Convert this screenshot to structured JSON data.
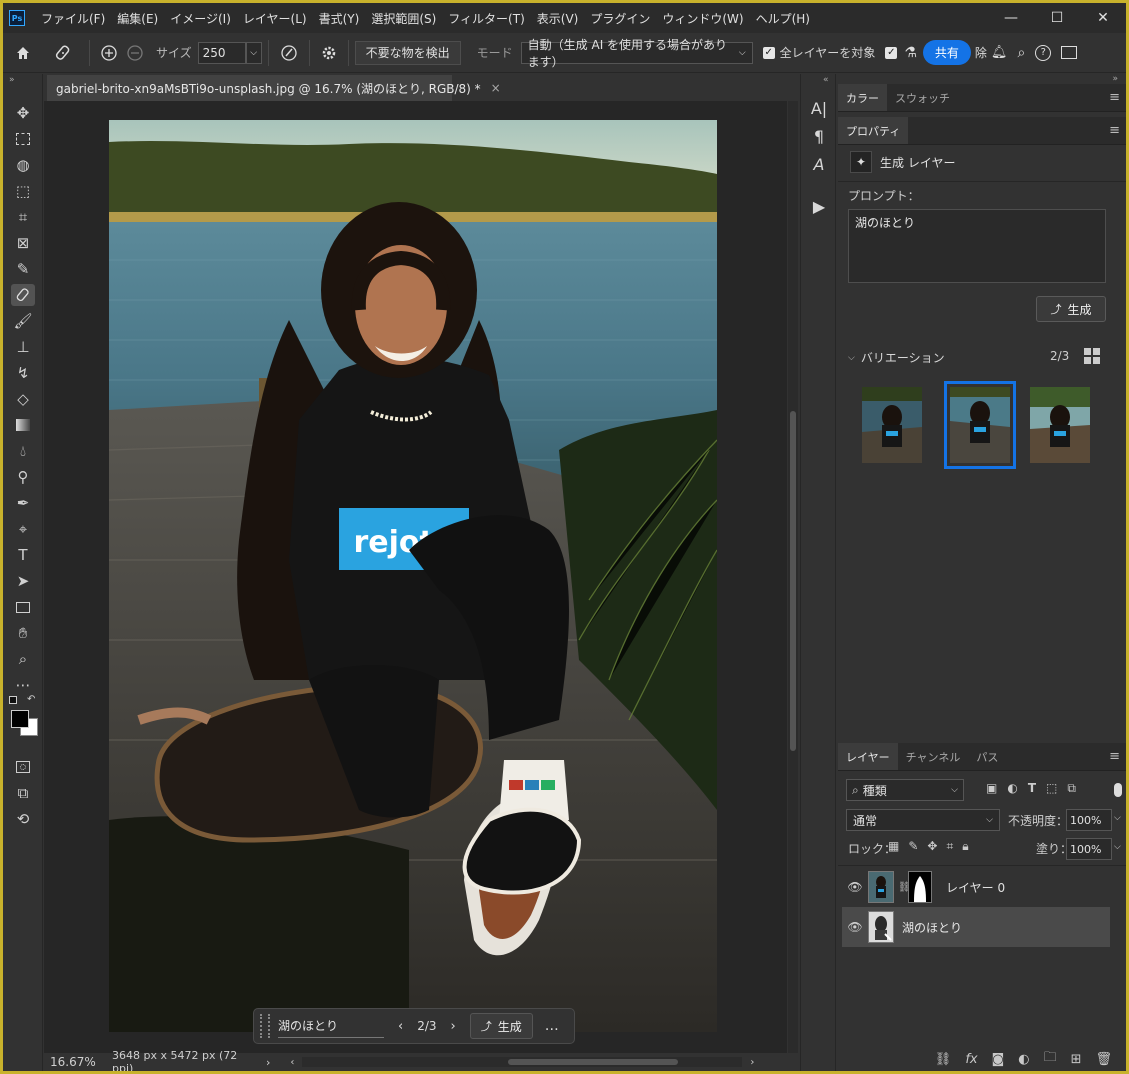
{
  "app": {
    "logo": "Ps"
  },
  "menu": [
    "ファイル(F)",
    "編集(E)",
    "イメージ(I)",
    "レイヤー(L)",
    "書式(Y)",
    "選択範囲(S)",
    "フィルター(T)",
    "表示(V)",
    "プラグイン",
    "ウィンドウ(W)",
    "ヘルプ(H)"
  ],
  "window_controls": {
    "minimize": "—",
    "maximize": "☐",
    "close": "✕"
  },
  "options": {
    "size_label": "サイズ",
    "size_value": "250",
    "detect_button": "不要な物を検出",
    "mode_label": "モード",
    "mode_value": "自動（生成 AI を使用する場合があります）",
    "all_layers_label": "全レイヤーを対象",
    "share_button": "共有",
    "remove_label": "除"
  },
  "document": {
    "tab_title": "gabriel-brito-xn9aMsBTi9o-unsplash.jpg @ 16.7% (湖のほとり, RGB/8) *",
    "close_glyph": "×",
    "photo_text": "rejoto"
  },
  "context_bar": {
    "prompt": "湖のほとり",
    "counter": "2/3",
    "generate": "生成",
    "more": "…"
  },
  "status": {
    "zoom": "16.67%",
    "dimensions": "3648 px x 5472 px (72 ppi)"
  },
  "color_panel": {
    "tabs": [
      "カラー",
      "スウォッチ"
    ]
  },
  "properties": {
    "tab": "プロパティ",
    "layer_type": "生成 レイヤー",
    "prompt_label": "プロンプト：",
    "prompt_value": "湖のほとり",
    "generate_button": "生成",
    "variations_label": "バリエーション",
    "variations_count": "2/3"
  },
  "layers_panel": {
    "tabs": [
      "レイヤー",
      "チャンネル",
      "パス"
    ],
    "filter_kind": "種類",
    "blend_mode": "通常",
    "opacity_label": "不透明度：",
    "opacity_value": "100%",
    "lock_label": "ロック：",
    "fill_label": "塗り：",
    "fill_value": "100%",
    "layers": [
      {
        "name": "レイヤー 0",
        "selected": false
      },
      {
        "name": "湖のほとり",
        "selected": true
      }
    ]
  },
  "colors": {
    "accent": "#1473e6",
    "tee_print": "#2aa3e0",
    "frame": "#c8b22c"
  }
}
